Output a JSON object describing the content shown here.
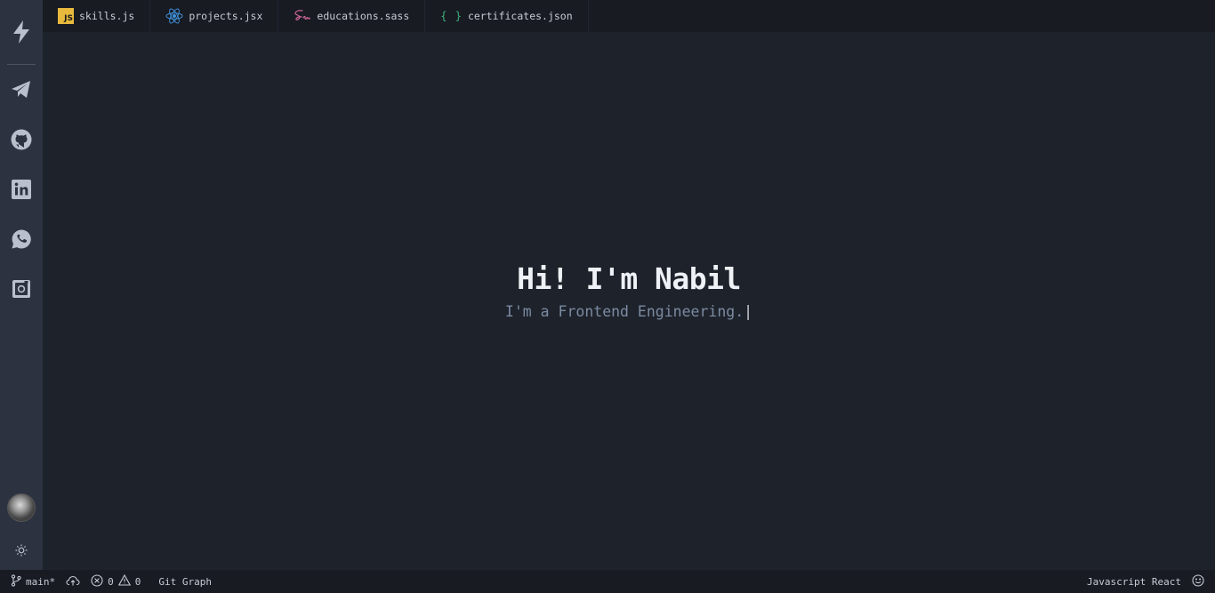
{
  "sidebar": {
    "logo_icon": "lightning-bolt-icon",
    "links": [
      {
        "name": "telegram",
        "icon": "telegram-icon"
      },
      {
        "name": "github",
        "icon": "github-icon"
      },
      {
        "name": "linkedin",
        "icon": "linkedin-icon"
      },
      {
        "name": "whatsapp",
        "icon": "whatsapp-icon"
      },
      {
        "name": "instagram",
        "icon": "instagram-icon"
      }
    ],
    "theme_icon": "sun-icon"
  },
  "tabs": [
    {
      "label": "skills.js",
      "icon": "javascript-icon",
      "icon_text": "JS"
    },
    {
      "label": "projects.jsx",
      "icon": "react-icon"
    },
    {
      "label": "educations.sass",
      "icon": "sass-icon"
    },
    {
      "label": "certificates.json",
      "icon": "json-icon",
      "icon_text": "{ }"
    }
  ],
  "hero": {
    "title": "Hi! I'm Nabil",
    "subtitle": "I'm a Frontend Engineering.",
    "caret": "|"
  },
  "statusbar": {
    "branch": "main*",
    "errors": "0",
    "warnings": "0",
    "git_graph": "Git Graph",
    "language": "Javascript React"
  },
  "colors": {
    "activity_bar": "#2c3240",
    "editor_bg": "#1e222b",
    "tabbar_bg": "#181b22",
    "js_yellow": "#e8b93c",
    "react_blue": "#3f8fd8",
    "sass_pink": "#cd6799",
    "json_green": "#3fb17c"
  }
}
